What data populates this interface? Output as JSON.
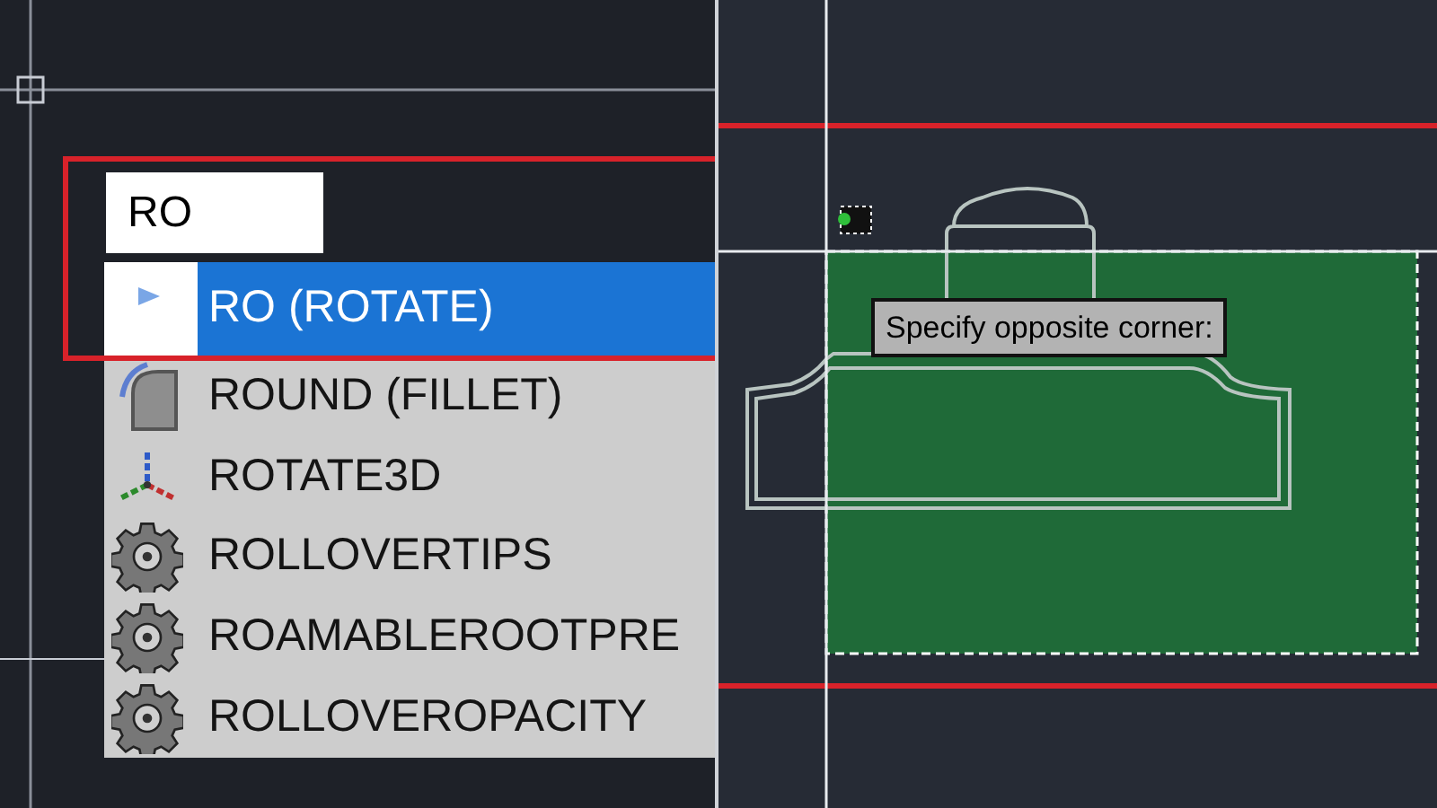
{
  "command_input": {
    "value": "RO"
  },
  "suggestions": [
    {
      "label": "RO (ROTATE)",
      "kind": "rotate",
      "selected": true
    },
    {
      "label": "ROUND (FILLET)",
      "kind": "fillet",
      "selected": false
    },
    {
      "label": "ROTATE3D",
      "kind": "rotate3d",
      "selected": false
    },
    {
      "label": "ROLLOVERTIPS",
      "kind": "setting",
      "selected": false
    },
    {
      "label": "ROAMABLEROOTPRE",
      "kind": "setting",
      "selected": false
    },
    {
      "label": "ROLLOVEROPACITY",
      "kind": "setting",
      "selected": false
    }
  ],
  "tooltip": {
    "text": "Specify opposite corner:"
  }
}
